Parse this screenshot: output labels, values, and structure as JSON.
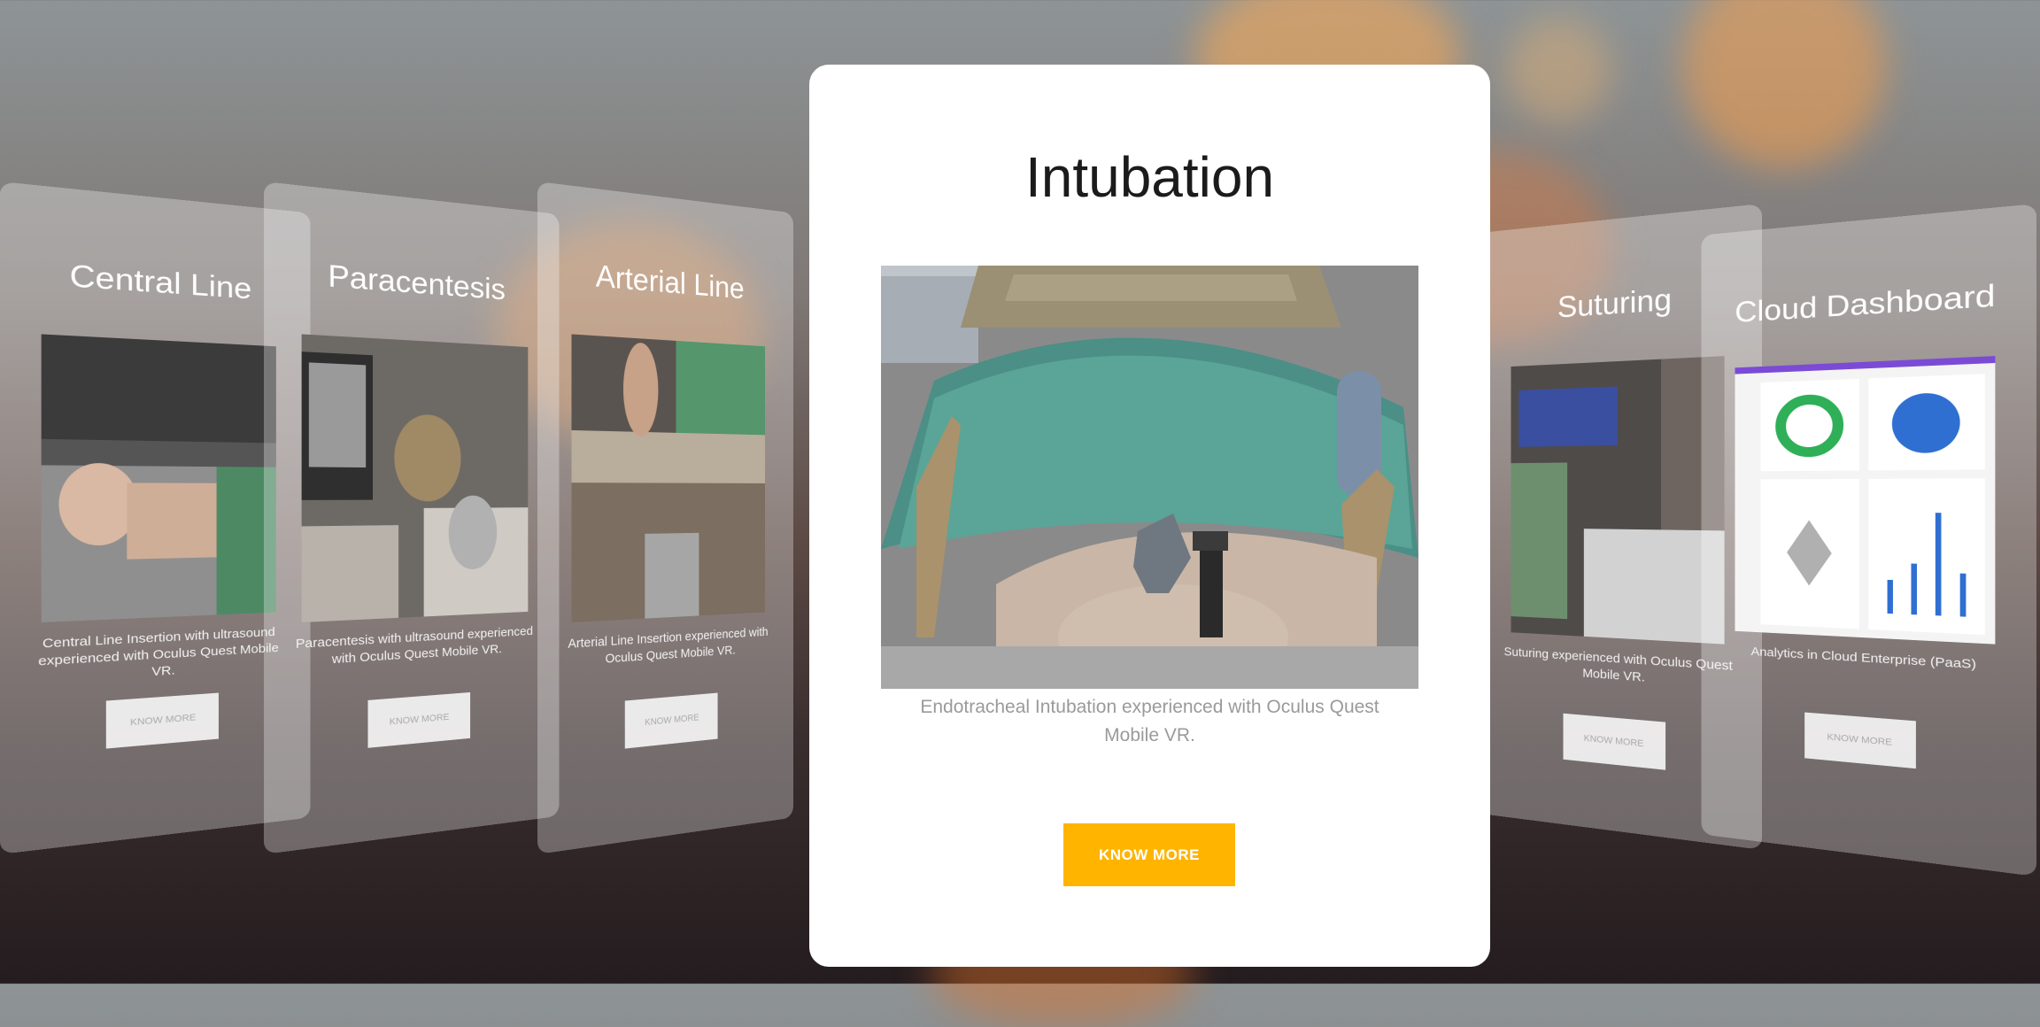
{
  "carousel": {
    "left_cards": [
      {
        "title": "Central Line",
        "description": "Central Line Insertion with ultrasound experienced with Oculus Quest Mobile VR.",
        "button": "KNOW MORE"
      },
      {
        "title": "Paracentesis",
        "description": "Paracentesis with ultrasound experienced with Oculus Quest Mobile VR.",
        "button": "KNOW MORE"
      },
      {
        "title": "Arterial Line",
        "description": "Arterial Line Insertion experienced with Oculus Quest Mobile VR.",
        "button": "KNOW MORE"
      }
    ],
    "featured": {
      "title": "Intubation",
      "description": "Endotracheal Intubation experienced with Oculus Quest Mobile VR.",
      "button": "KNOW MORE"
    },
    "right_cards": [
      {
        "title": "Suturing",
        "description": "Suturing experienced with Oculus Quest Mobile VR.",
        "button": "KNOW MORE"
      },
      {
        "title": "Cloud Dashboard",
        "description": "Analytics in Cloud Enterprise (PaaS)",
        "button": "KNOW MORE"
      }
    ]
  },
  "colors": {
    "accent": "#ffb400",
    "card_bg": "#ffffff"
  }
}
